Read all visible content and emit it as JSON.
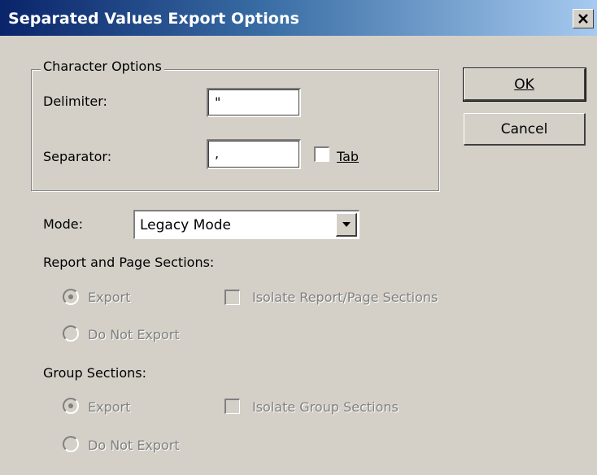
{
  "window": {
    "title": "Separated Values Export Options",
    "close_glyph": "✕"
  },
  "character_options": {
    "legend": "Character Options",
    "delimiter_label": "Delimiter:",
    "delimiter_value": "\"",
    "separator_label": "Separator:",
    "separator_value": ",",
    "tab_label": "Tab",
    "tab_checked": false
  },
  "buttons": {
    "ok_label": "OK",
    "cancel_label": "Cancel"
  },
  "mode": {
    "label": "Mode:",
    "value": "Legacy Mode"
  },
  "report_page_sections": {
    "heading": "Report and Page Sections:",
    "export_label": "Export",
    "do_not_export_label": "Do Not Export",
    "isolate_label": "Isolate Report/Page Sections",
    "selected": "Export"
  },
  "group_sections": {
    "heading": "Group Sections:",
    "export_label": "Export",
    "do_not_export_label": "Do Not Export",
    "isolate_label": "Isolate Group Sections",
    "selected": "Export"
  },
  "icons": {
    "close": "close-icon",
    "dropdown": "dropdown-arrow-icon"
  }
}
